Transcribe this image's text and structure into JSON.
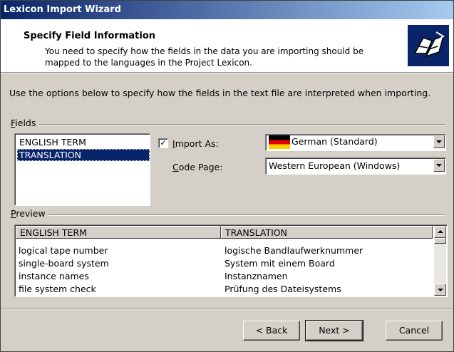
{
  "window": {
    "title": "Lexicon Import Wizard"
  },
  "header": {
    "title": "Specify Field Information",
    "subtitle": "You need to specify how the fields in the data you are importing should be mapped to the languages in the Project Lexicon.",
    "icon": "import-wizard-icon"
  },
  "description": "Use the options below to specify how the fields in the text file are interpreted when importing.",
  "fields": {
    "label_prefix": "",
    "label_hotkey": "F",
    "label_rest": "ields",
    "items": [
      {
        "label": "ENGLISH TERM",
        "selected": false
      },
      {
        "label": "TRANSLATION",
        "selected": true
      }
    ]
  },
  "import_as": {
    "checked": true,
    "check_mark": "✓",
    "label_hotkey": "I",
    "label_rest": "mport As:",
    "value": "German (Standard)",
    "flag": "german-flag-icon"
  },
  "code_page": {
    "label_hotkey": "C",
    "label_rest": "ode Page:",
    "value": "Western European (Windows)"
  },
  "preview": {
    "label_hotkey": "P",
    "label_rest": "review",
    "columns": [
      "ENGLISH TERM",
      "TRANSLATION"
    ],
    "rows": [
      [
        "logical tape number",
        "logische Bandlaufwerknummer"
      ],
      [
        "single-board system",
        "System mit einem Board"
      ],
      [
        "instance names",
        "Instanznamen"
      ],
      [
        "file system check",
        "Prüfung des Dateisystems"
      ]
    ]
  },
  "buttons": {
    "back": "< Back",
    "next": "Next >",
    "cancel": "Cancel"
  }
}
